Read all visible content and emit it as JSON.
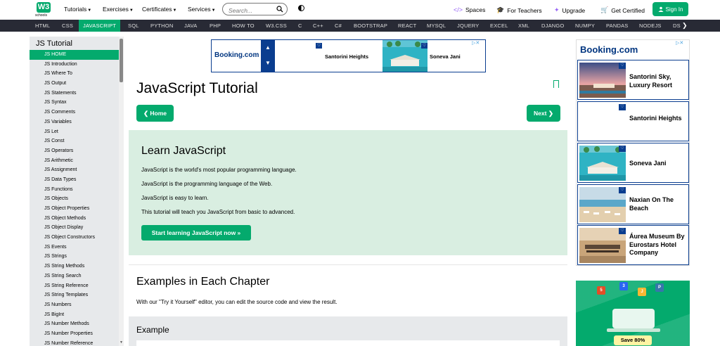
{
  "header": {
    "logo_text": "W3",
    "logo_sub": "schools",
    "menus": [
      "Tutorials",
      "Exercises",
      "Certificates",
      "Services"
    ],
    "search_placeholder": "Search...",
    "links": [
      {
        "icon": "</>",
        "label": "Spaces"
      },
      {
        "icon": "🎓",
        "label": "For Teachers"
      },
      {
        "icon": "✦",
        "label": "Upgrade"
      },
      {
        "icon": "🛒",
        "label": "Get Certified"
      }
    ],
    "signin_label": "Sign In"
  },
  "topnav": [
    "HTML",
    "CSS",
    "JAVASCRIPT",
    "SQL",
    "PYTHON",
    "JAVA",
    "PHP",
    "HOW TO",
    "W3.CSS",
    "C",
    "C++",
    "C#",
    "BOOTSTRAP",
    "REACT",
    "MYSQL",
    "JQUERY",
    "EXCEL",
    "XML",
    "DJANGO",
    "NUMPY",
    "PANDAS",
    "NODEJS",
    "DS"
  ],
  "topnav_active": "JAVASCRIPT",
  "sidebar": {
    "heading": "JS Tutorial",
    "items": [
      "JS HOME",
      "JS Introduction",
      "JS Where To",
      "JS Output",
      "JS Statements",
      "JS Syntax",
      "JS Comments",
      "JS Variables",
      "JS Let",
      "JS Const",
      "JS Operators",
      "JS Arithmetic",
      "JS Assignment",
      "JS Data Types",
      "JS Functions",
      "JS Objects",
      "JS Object Properties",
      "JS Object Methods",
      "JS Object Display",
      "JS Object Constructors",
      "JS Events",
      "JS Strings",
      "JS String Methods",
      "JS String Search",
      "JS String Reference",
      "JS String Templates",
      "JS Numbers",
      "JS BigInt",
      "JS Number Methods",
      "JS Number Properties",
      "JS Number Reference"
    ]
  },
  "top_ad": {
    "brand": "Booking.com",
    "hotels": [
      "Santorini Heights",
      "Soneva Jani"
    ]
  },
  "main": {
    "title": "JavaScript Tutorial",
    "home_label": "❮ Home",
    "next_label": "Next ❯",
    "learn": {
      "heading": "Learn JavaScript",
      "lines": [
        "JavaScript is the world's most popular programming language.",
        "JavaScript is the programming language of the Web.",
        "JavaScript is easy to learn.",
        "This tutorial will teach you JavaScript from basic to advanced."
      ],
      "cta": "Start learning JavaScript now »"
    },
    "examples_heading": "Examples in Each Chapter",
    "examples_text": "With our \"Try it Yourself\" editor, you can edit the source code and view the result.",
    "example_label": "Example"
  },
  "right_ad": {
    "brand": "Booking.com",
    "hotels": [
      "Santorini Sky, Luxury Resort",
      "Santorini Heights",
      "Soneva Jani",
      "Naxian On The Beach",
      "Áurea Museum By Eurostars Hotel Company"
    ]
  },
  "promo": {
    "save_label": "Save 80%"
  },
  "colors": {
    "brand_green": "#04AA6D",
    "nav_dark": "#282A35",
    "sidebar_bg": "#E7E9EB",
    "learn_bg": "#D9EEE1",
    "booking_blue": "#003580"
  }
}
